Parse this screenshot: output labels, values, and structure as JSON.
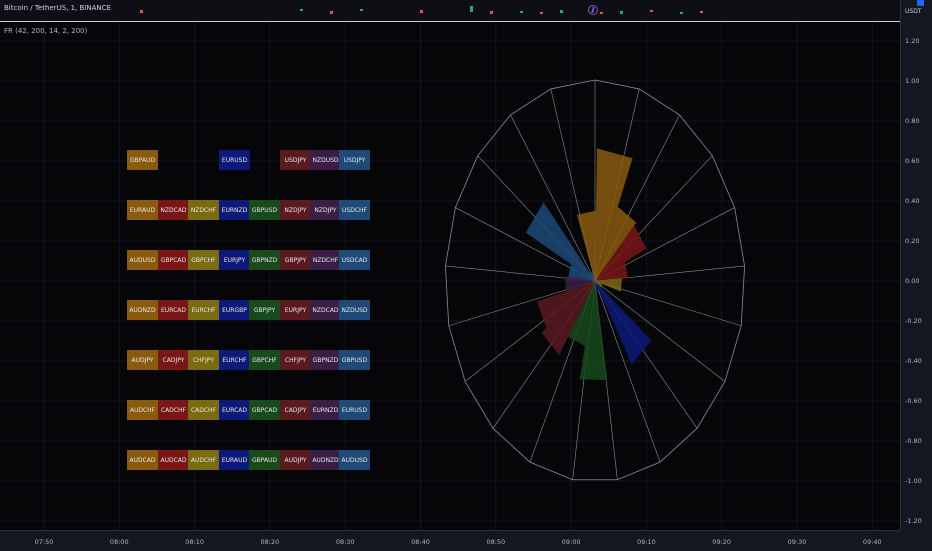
{
  "header": {
    "symbol_title": "Bitcoin / TetherUS, 1, BINANCE",
    "currency": "USDT",
    "event_icon": "lightning-icon"
  },
  "indicator": {
    "label": "FR (42, 200, 14, 2, 200)"
  },
  "y_axis": {
    "ticks": [
      "1.20",
      "1.00",
      "0.80",
      "0.60",
      "0.40",
      "0.20",
      "0.00",
      "-0.20",
      "-0.40",
      "-0.60",
      "-0.80",
      "-1.00",
      "-1.20"
    ]
  },
  "x_axis": {
    "ticks": [
      "07:50",
      "08:00",
      "08:10",
      "08:20",
      "08:30",
      "08:40",
      "08:50",
      "09:00",
      "09:10",
      "09:20",
      "09:30",
      "09:40"
    ]
  },
  "colors": {
    "orange": "#8a5a0f",
    "red": "#7a1616",
    "olive": "#7a6a10",
    "navy": "#0d1a7a",
    "green": "#184a1c",
    "maroon": "#5a1a20",
    "purple": "#3b1e46",
    "blue": "#1f4a78"
  },
  "currency_table": {
    "rows": [
      [
        "GBPAUD",
        "",
        "",
        "EURUSD",
        "",
        "USDJPY",
        "NZDUSD",
        "USDJPY"
      ],
      [
        "EURAUD",
        "NZDCAD",
        "NZDCHF",
        "EURNZD",
        "GBPUSD",
        "NZDJPY",
        "NZDJPY",
        "USDCHF"
      ],
      [
        "AUDUSD",
        "GBPCAD",
        "GBPCHF",
        "EURJPY",
        "GBPNZD",
        "GBPJPY",
        "NZDCHF",
        "USDCAD"
      ],
      [
        "AUDNZD",
        "EURCAD",
        "EURCHF",
        "EURGBP",
        "GBPJPY",
        "EURJPY",
        "NZDCAD",
        "NZDUSD"
      ],
      [
        "AUDJPY",
        "CADJPY",
        "CHFJPY",
        "EURCHF",
        "GBPCHF",
        "CHFJPY",
        "GBPNZD",
        "GBPUSD"
      ],
      [
        "AUDCHF",
        "CADCHF",
        "CADCHF",
        "EURCAD",
        "GBPCAD",
        "CADJPY",
        "EURNZD",
        "EURUSD"
      ],
      [
        "AUDCAD",
        "AUDCAD",
        "AUDCHF",
        "EURAUD",
        "GBPAUD",
        "AUDJPY",
        "AUDNZD",
        "AUDUSD"
      ]
    ],
    "column_colors": [
      "orange",
      "red",
      "olive",
      "navy",
      "green",
      "maroon",
      "purple",
      "blue"
    ]
  },
  "radar": {
    "spokes": 21,
    "sectors": [
      {
        "color": "orange",
        "radius": 0.35
      },
      {
        "color": "orange",
        "radius": 0.66
      },
      {
        "color": "orange",
        "radius": 0.4
      },
      {
        "color": "red",
        "radius": 0.38
      },
      {
        "color": "red",
        "radius": 0.22
      },
      {
        "color": "olive",
        "radius": 0.18
      },
      {
        "color": "olive",
        "radius": 0.05
      },
      {
        "color": "navy",
        "radius": 0.48
      },
      {
        "color": "navy",
        "radius": 0.05
      },
      {
        "color": "green",
        "radius": 0.5
      },
      {
        "color": "green",
        "radius": 0.33
      },
      {
        "color": "maroon",
        "radius": 0.44
      },
      {
        "color": "maroon",
        "radius": 0.4
      },
      {
        "color": "purple",
        "radius": 0.2
      },
      {
        "color": "blue",
        "radius": 0.18
      },
      {
        "color": "blue",
        "radius": 0.52
      },
      {
        "color": "blue",
        "radius": 0.05
      }
    ]
  }
}
